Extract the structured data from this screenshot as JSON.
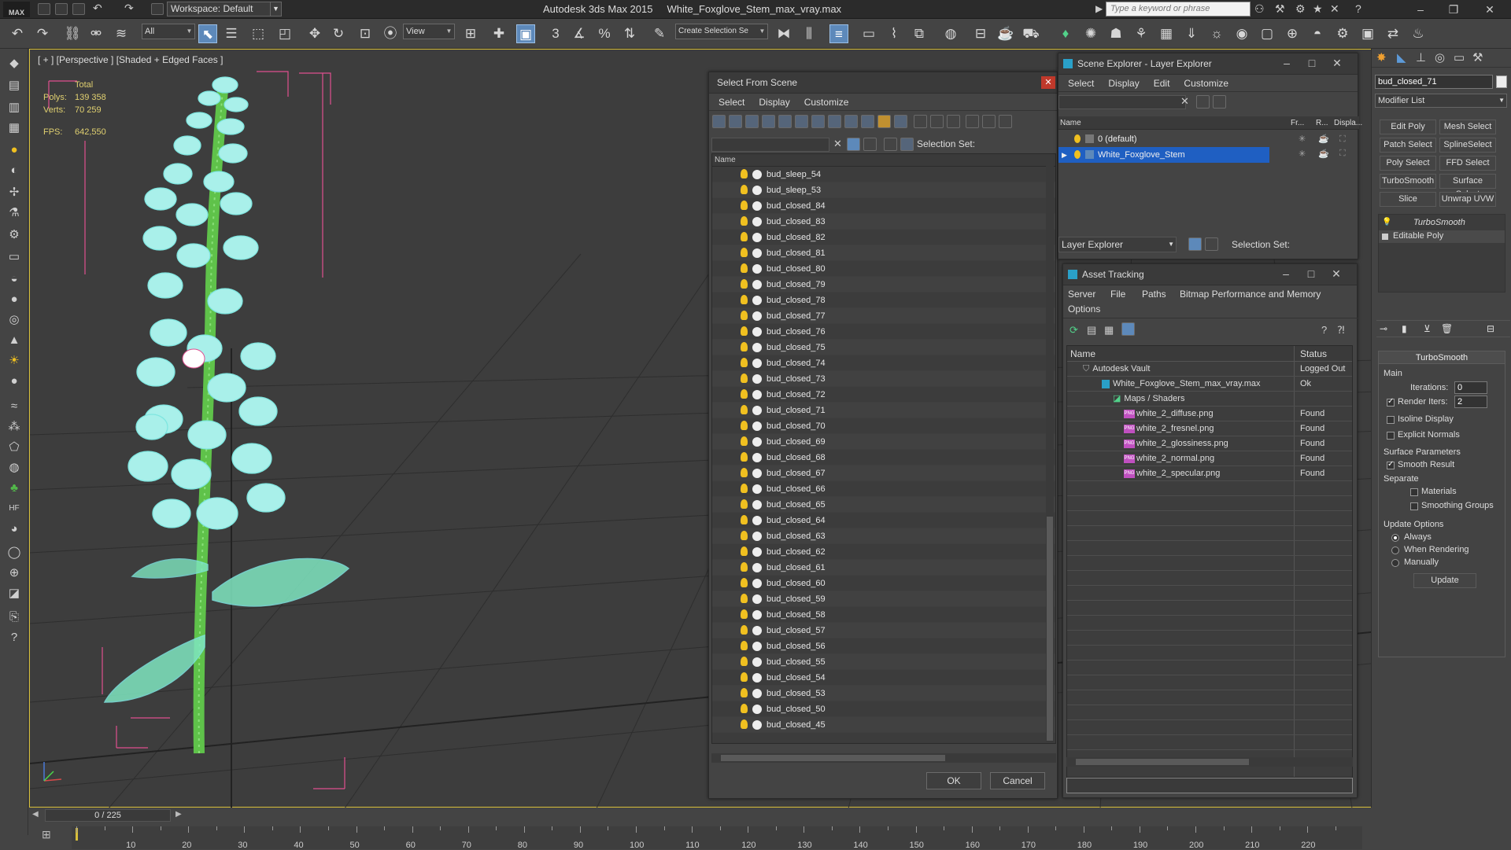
{
  "app": {
    "logo_text": "MAX",
    "workspace": "Workspace: Default",
    "product": "Autodesk 3ds Max  2015",
    "file": "White_Foxglove_Stem_max_vray.max",
    "search_placeholder": "Type a keyword or phrase"
  },
  "toolbar": {
    "selection_filter": "All",
    "ref_coord": "View",
    "snap_label": "3",
    "named_selection_placeholder": "Create Selection Se"
  },
  "viewport": {
    "label": "[ + ] [Perspective ] [Shaded + Edged Faces ]",
    "stats": {
      "total_label": "Total",
      "polys_label": "Polys:",
      "polys_value": "139 358",
      "verts_label": "Verts:",
      "verts_value": "70 259",
      "fps_label": "FPS:",
      "fps_value": "642,550"
    }
  },
  "select_from_scene": {
    "title": "Select From Scene",
    "menu": [
      "Select",
      "Display",
      "Customize"
    ],
    "selection_set_label": "Selection Set:",
    "column_name": "Name",
    "items": [
      "bud_sleep_54",
      "bud_sleep_53",
      "bud_closed_84",
      "bud_closed_83",
      "bud_closed_82",
      "bud_closed_81",
      "bud_closed_80",
      "bud_closed_79",
      "bud_closed_78",
      "bud_closed_77",
      "bud_closed_76",
      "bud_closed_75",
      "bud_closed_74",
      "bud_closed_73",
      "bud_closed_72",
      "bud_closed_71",
      "bud_closed_70",
      "bud_closed_69",
      "bud_closed_68",
      "bud_closed_67",
      "bud_closed_66",
      "bud_closed_65",
      "bud_closed_64",
      "bud_closed_63",
      "bud_closed_62",
      "bud_closed_61",
      "bud_closed_60",
      "bud_closed_59",
      "bud_closed_58",
      "bud_closed_57",
      "bud_closed_56",
      "bud_closed_55",
      "bud_closed_54",
      "bud_closed_53",
      "bud_closed_50",
      "bud_closed_45"
    ],
    "ok_label": "OK",
    "cancel_label": "Cancel"
  },
  "scene_explorer": {
    "title": "Scene Explorer - Layer Explorer",
    "menu": [
      "Select",
      "Display",
      "Edit",
      "Customize"
    ],
    "columns": [
      "Name",
      "Fr...",
      "R...",
      "Displa..."
    ],
    "layers": [
      "0 (default)",
      "White_Foxglove_Stem"
    ],
    "footer_combo": "Layer Explorer",
    "selection_set_label": "Selection Set:"
  },
  "asset_tracking": {
    "title": "Asset Tracking",
    "menu": [
      "Server",
      "File",
      "Paths",
      "Bitmap Performance and Memory",
      "Options"
    ],
    "columns": [
      "Name",
      "Status"
    ],
    "rows": [
      {
        "name": "Autodesk Vault",
        "status": "Logged Out"
      },
      {
        "name": "White_Foxglove_Stem_max_vray.max",
        "status": "Ok"
      },
      {
        "name": "Maps / Shaders",
        "status": ""
      },
      {
        "name": "white_2_diffuse.png",
        "status": "Found"
      },
      {
        "name": "white_2_fresnel.png",
        "status": "Found"
      },
      {
        "name": "white_2_glossiness.png",
        "status": "Found"
      },
      {
        "name": "white_2_normal.png",
        "status": "Found"
      },
      {
        "name": "white_2_specular.png",
        "status": "Found"
      }
    ]
  },
  "command_panel": {
    "object_name": "bud_closed_71",
    "modifier_list": "Modifier List",
    "buttons": [
      "Edit Poly",
      "Mesh Select",
      "Patch Select",
      "SplineSelect",
      "Poly Select",
      "FFD Select",
      "TurboSmooth",
      "Surface Select",
      "Slice",
      "Unwrap UVW"
    ],
    "stack": [
      "TurboSmooth",
      "Editable Poly"
    ],
    "rollout_title": "TurboSmooth",
    "main_label": "Main",
    "iterations_label": "Iterations:",
    "iterations_value": "0",
    "render_iters_label": "Render Iters:",
    "render_iters_value": "2",
    "isoline_label": "Isoline Display",
    "explicit_normals_label": "Explicit Normals",
    "surface_params_label": "Surface Parameters",
    "smooth_result_label": "Smooth Result",
    "separate_label": "Separate",
    "materials_label": "Materials",
    "smoothing_groups_label": "Smoothing Groups",
    "update_options_label": "Update Options",
    "always_label": "Always",
    "when_rendering_label": "When Rendering",
    "manually_label": "Manually",
    "update_button": "Update"
  },
  "timeline": {
    "frame_indicator": "0 / 225",
    "ticks": [
      "10",
      "20",
      "30",
      "40",
      "50",
      "60",
      "70",
      "80",
      "90",
      "100",
      "110",
      "120",
      "130",
      "140",
      "150",
      "160",
      "170",
      "180",
      "190",
      "200",
      "210",
      "220"
    ]
  },
  "colors": {
    "wireframe": "#7fe6e0",
    "stem": "#5fc24a",
    "selection_highlight": "#1f5fc2",
    "viewport_border": "#d8bf3a"
  }
}
